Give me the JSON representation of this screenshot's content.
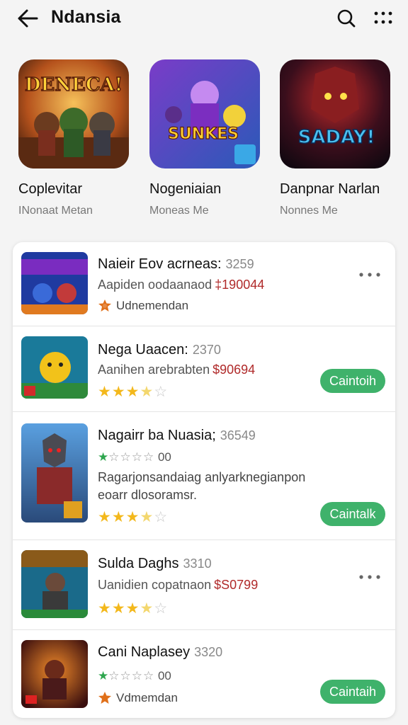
{
  "header": {
    "title": "Ndansia",
    "icons": [
      "back-arrow-icon",
      "search-icon",
      "more-vertical-dots-icon"
    ]
  },
  "featured": [
    {
      "title": "Coplevitar",
      "subtitle": "INonaat Metan",
      "art_text": "DENECA!"
    },
    {
      "title": "Nogeniaian",
      "subtitle": "Moneas Me",
      "art_text": "SUNKES"
    },
    {
      "title": "Danpnar Narlan",
      "subtitle": "Nonnes Me",
      "art_text": "SADAY!"
    }
  ],
  "list": [
    {
      "title": "Naieir Eov acrneas:",
      "count": "3259",
      "line2": "Aapiden oodaanaod",
      "price": "‡190044",
      "meta": "Udnemendan",
      "action": "more"
    },
    {
      "title": "Nega Uaacen:",
      "count": "2370",
      "line2": "Aanihen arebrabten",
      "price": "$90694",
      "rating": 3.5,
      "button": "Caintoih"
    },
    {
      "title": "Nagairr ba Nuasia;",
      "count": "36549",
      "mini_rating": "00",
      "desc": "Ragarjonsandaiag anlyarknegianpon eoarr dlosoramsr.",
      "rating": 3.5,
      "button": "Caintalk"
    },
    {
      "title": "Sulda Daghs",
      "count": "3310",
      "line2": "Uanidien copatnaon",
      "price": "$S0799",
      "rating": 3.5,
      "action": "more"
    },
    {
      "title": "Cani Naplasey",
      "count": "3320",
      "mini_rating": "00",
      "meta": "Vdmemdan",
      "button": "Caintaih"
    }
  ],
  "colors": {
    "accent_green": "#3fb26b",
    "star": "#f3b81c",
    "price_red": "#b02a2a",
    "background": "#f4f4f4"
  }
}
